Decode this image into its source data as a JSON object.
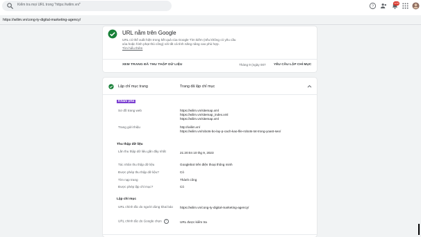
{
  "search": {
    "placeholder": "Kiểm tra mọi URL trong \"https://wilim.vn/\""
  },
  "header_icons": [
    "help-icon",
    "people-icon",
    "notifications-icon",
    "apps-icon",
    "account-avatar"
  ],
  "notifications": {
    "count": "100"
  },
  "inspected_url": "https://wilim.vn/cong-ty-digital-marketing-agency/",
  "google_card": {
    "title": "URL nằm trên Google",
    "desc_lines": [
      "URL có thể xuất hiện trong kết quả của Google Tìm kiếm (nếu không có yêu cầu",
      "xóa hoặc hình phạt thủ công) với tất cả tính năng nâng cao phù hợp.",
      "Tìm hiểu thêm"
    ],
    "view_button": "XEM TRANG ĐÃ THU THẬP DỮ LIỆU",
    "date_text": "Tháng 9 (ngày 007",
    "request_button": "YÊU CẦU LẬP CHỈ MỤC"
  },
  "indexing_card": {
    "title": "Lập chỉ mục trang",
    "status": "Trang đã lập chỉ mục",
    "discover": {
      "heading": "Khám phá",
      "sitemaps_label": "Sơ đồ trang web",
      "sitemaps": [
        "https://wilim.vn/sitemap.xml",
        "https://wilim.vn/sitemap_index.xml",
        "https://wilim.vn/sitemap.xml"
      ],
      "referring_label": "Trang giới thiệu",
      "referring": [
        "http://wilim.vn/",
        "https://wilim.vn/robots-bo-lay-p-cach-kao-file-robots-txt-trong-yoast-seo/"
      ]
    },
    "crawl": {
      "heading": "Thu thập dữ liệu",
      "rows": [
        {
          "label": "Lần thu thập dữ liệu gần đây nhất",
          "value": "21:20:04 10 thg 9, 2023"
        },
        {
          "label": "Tác nhân thu thập dữ liệu",
          "value": "Googlebot trên điện thoại thông minh"
        },
        {
          "label": "Được phép thu thập dữ liệu?",
          "value": "Có"
        },
        {
          "label": "Tìm nạp trang",
          "value": "Thành công"
        },
        {
          "label": "Được phép lập chỉ mục?",
          "value": "Có"
        }
      ]
    },
    "indexing": {
      "heading": "Lập chỉ mục",
      "rows": [
        {
          "label": "URL chính tắc do người dùng khai báo",
          "value": "https://wilim.vn/cong-ty-digital-marketing-agency/"
        },
        {
          "label": "URL chính tắc do Google chọn",
          "value": "URL được kiểm tra"
        }
      ]
    }
  },
  "colors": {
    "accent": "#188038",
    "highlight": "#7b3fd1",
    "badge": "#d93025"
  }
}
